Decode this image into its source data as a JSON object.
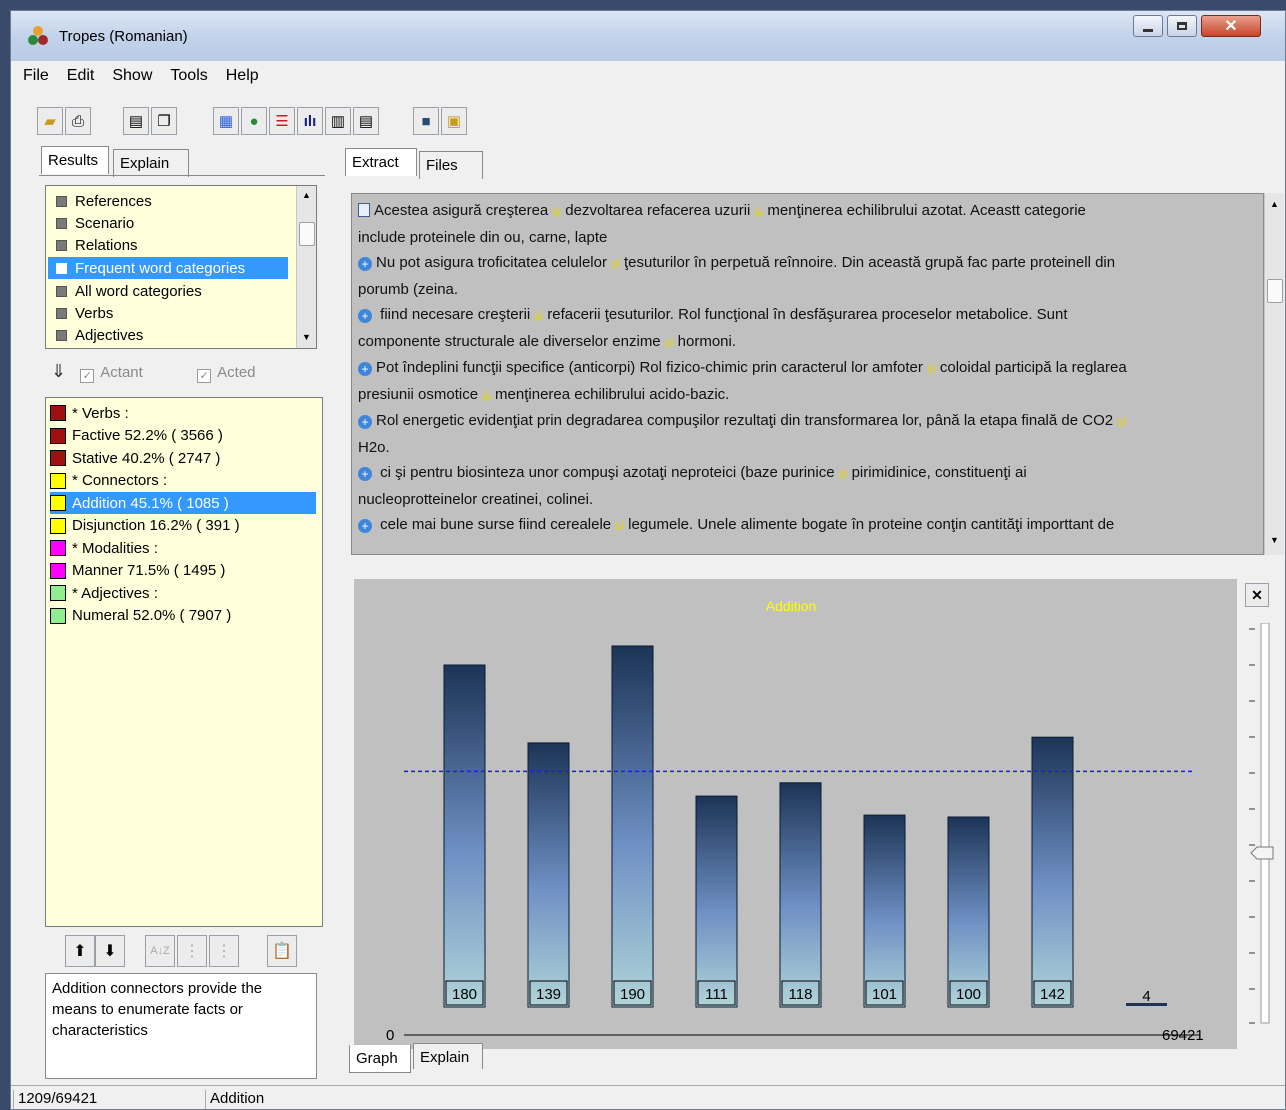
{
  "window": {
    "title": "Tropes (Romanian)"
  },
  "menu": [
    "File",
    "Edit",
    "Show",
    "Tools",
    "Help"
  ],
  "left_tabs": [
    "Results",
    "Explain"
  ],
  "result_items": [
    "References",
    "Scenario",
    "Relations",
    "Frequent word categories",
    "All word categories",
    "Verbs",
    "Adjectives"
  ],
  "selected_result": 3,
  "checks": {
    "actant": "Actant",
    "acted": "Acted"
  },
  "categories": [
    {
      "label": "* Verbs :",
      "color": "#a01010",
      "sel": false
    },
    {
      "label": "Factive  52.2% ( 3566 )",
      "color": "#a01010",
      "sel": false
    },
    {
      "label": "Stative  40.2% ( 2747 )",
      "color": "#a01010",
      "sel": false
    },
    {
      "label": "* Connectors :",
      "color": "#ffff00",
      "sel": false
    },
    {
      "label": "Addition  45.1% ( 1085 )",
      "color": "#ffff00",
      "sel": true
    },
    {
      "label": "Disjunction  16.2% ( 391 )",
      "color": "#ffff00",
      "sel": false
    },
    {
      "label": "* Modalities :",
      "color": "#ff00ff",
      "sel": false
    },
    {
      "label": "Manner  71.5% ( 1495 )",
      "color": "#ff00ff",
      "sel": false
    },
    {
      "label": "* Adjectives :",
      "color": "#90ee90",
      "sel": false
    },
    {
      "label": "Numeral  52.0% ( 7907 )",
      "color": "#90ee90",
      "sel": false
    }
  ],
  "description": "Addition connectors provide the means to enumerate facts or characteristics",
  "top_tabs": [
    "Extract",
    "Files"
  ],
  "extract_lines": [
    {
      "icon": "doc",
      "parts": [
        "Acestea asigură creşterea ",
        "şi",
        " dezvoltarea refacerea uzurii ",
        "şi",
        " menţinerea echilibrului azotat. Aceastt categorie"
      ]
    },
    {
      "icon": "",
      "parts": [
        "include proteinele din ou, carne, lapte"
      ]
    },
    {
      "icon": "plus",
      "parts": [
        "Nu pot asigura troficitatea celulelor ",
        "şi",
        " ţesuturilor în perpetuă reînnoire. Din această grupă fac parte proteinell din"
      ]
    },
    {
      "icon": "",
      "parts": [
        "porumb (zeina."
      ]
    },
    {
      "icon": "plus",
      "parts": [
        " fiind necesare creşterii ",
        "şi",
        " refacerii ţesuturilor. Rol funcţional în desfăşurarea proceselor metabolice. Sunt"
      ]
    },
    {
      "icon": "",
      "parts": [
        "componente structurale ale diverselor enzime ",
        "şi",
        " hormoni."
      ]
    },
    {
      "icon": "plus",
      "parts": [
        "Pot îndeplini funcţii specifice (anticorpi) Rol fizico-chimic prin caracterul lor amfoter ",
        "şi",
        " coloidal participă la reglarea"
      ]
    },
    {
      "icon": "",
      "parts": [
        "presiunii osmotice ",
        "şi",
        " menţinerea echilibrului acido-bazic."
      ]
    },
    {
      "icon": "plus",
      "parts": [
        "Rol energetic evidenţiat prin degradarea compuşilor rezultaţi din transformarea lor, până la etapa finală de CO2 ",
        "şi"
      ]
    },
    {
      "icon": "",
      "parts": [
        "H2o."
      ]
    },
    {
      "icon": "plus",
      "parts": [
        " ci şi pentru biosinteza unor compuşi azotaţi neproteici (baze purinice ",
        "şi",
        " pirimidinice, constituenţi ai"
      ]
    },
    {
      "icon": "",
      "parts": [
        "nucleoprotteinelor creatinei, colinei."
      ]
    },
    {
      "icon": "plus",
      "parts": [
        " cele mai bune surse fiind cerealele ",
        "şi",
        " legumele. Unele alimente bogate în proteine conţin cantităţi importtant de"
      ]
    }
  ],
  "bottom_tabs": [
    "Graph",
    "Explain"
  ],
  "chart_data": {
    "type": "bar",
    "title": "Addition",
    "values": [
      180,
      139,
      190,
      111,
      118,
      101,
      100,
      142,
      4
    ],
    "average_line": 124,
    "x_start": "0",
    "x_end": "69421"
  },
  "status": {
    "position": "1209/69421",
    "category": "Addition"
  },
  "colors": {
    "title_text": "#ffff00",
    "avg_line": "#1a1aff",
    "bar_top": "#1c3456",
    "bar_bottom": "#b0d4d8"
  }
}
